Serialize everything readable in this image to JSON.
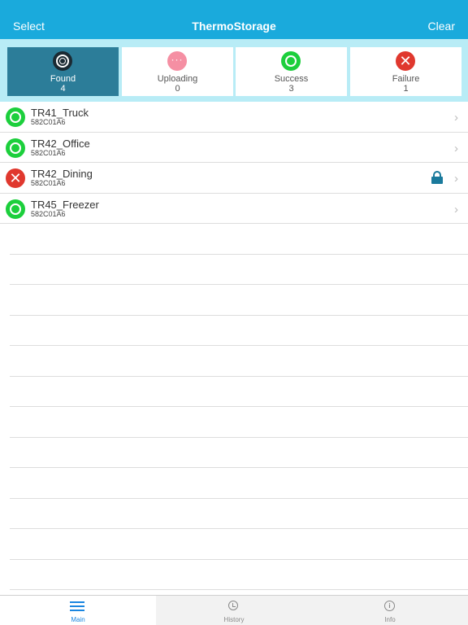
{
  "navbar": {
    "left_label": "Select",
    "title": "ThermoStorage",
    "right_label": "Clear",
    "color": "#1aaadc"
  },
  "filters": [
    {
      "label": "Found",
      "count": "4",
      "icon": "found-icon",
      "active": true
    },
    {
      "label": "Uploading",
      "count": "0",
      "icon": "uploading-icon",
      "glyph": "···"
    },
    {
      "label": "Success",
      "count": "3",
      "icon": "success-icon"
    },
    {
      "label": "Failure",
      "count": "1",
      "icon": "failure-icon",
      "glyph": "✕"
    }
  ],
  "devices": [
    {
      "name": "TR41_Truck",
      "serial": "582C01A6",
      "status": "success",
      "status_icon": "success-icon",
      "locked": false
    },
    {
      "name": "TR42_Office",
      "serial": "582C01A6",
      "status": "success",
      "status_icon": "success-icon",
      "locked": false
    },
    {
      "name": "TR42_Dining",
      "serial": "582C01A6",
      "status": "failure",
      "status_icon": "failure-icon",
      "glyph": "✕",
      "locked": true
    },
    {
      "name": "TR45_Freezer",
      "serial": "582C01A6",
      "status": "success",
      "status_icon": "success-icon",
      "locked": false
    }
  ],
  "chevron": "›",
  "tabbar": {
    "tabs": [
      {
        "label": "Main",
        "icon": "list-icon",
        "active": true
      },
      {
        "label": "History",
        "icon": "history-icon",
        "active": false
      },
      {
        "label": "Info",
        "icon": "info-icon",
        "active": false
      }
    ]
  },
  "colors": {
    "accent": "#1aaadc",
    "active_filter": "#2c7d99",
    "success": "#1ccf3c",
    "failure": "#e0382e",
    "uploading": "#f58fa3",
    "tab_active": "#1a86e0"
  }
}
